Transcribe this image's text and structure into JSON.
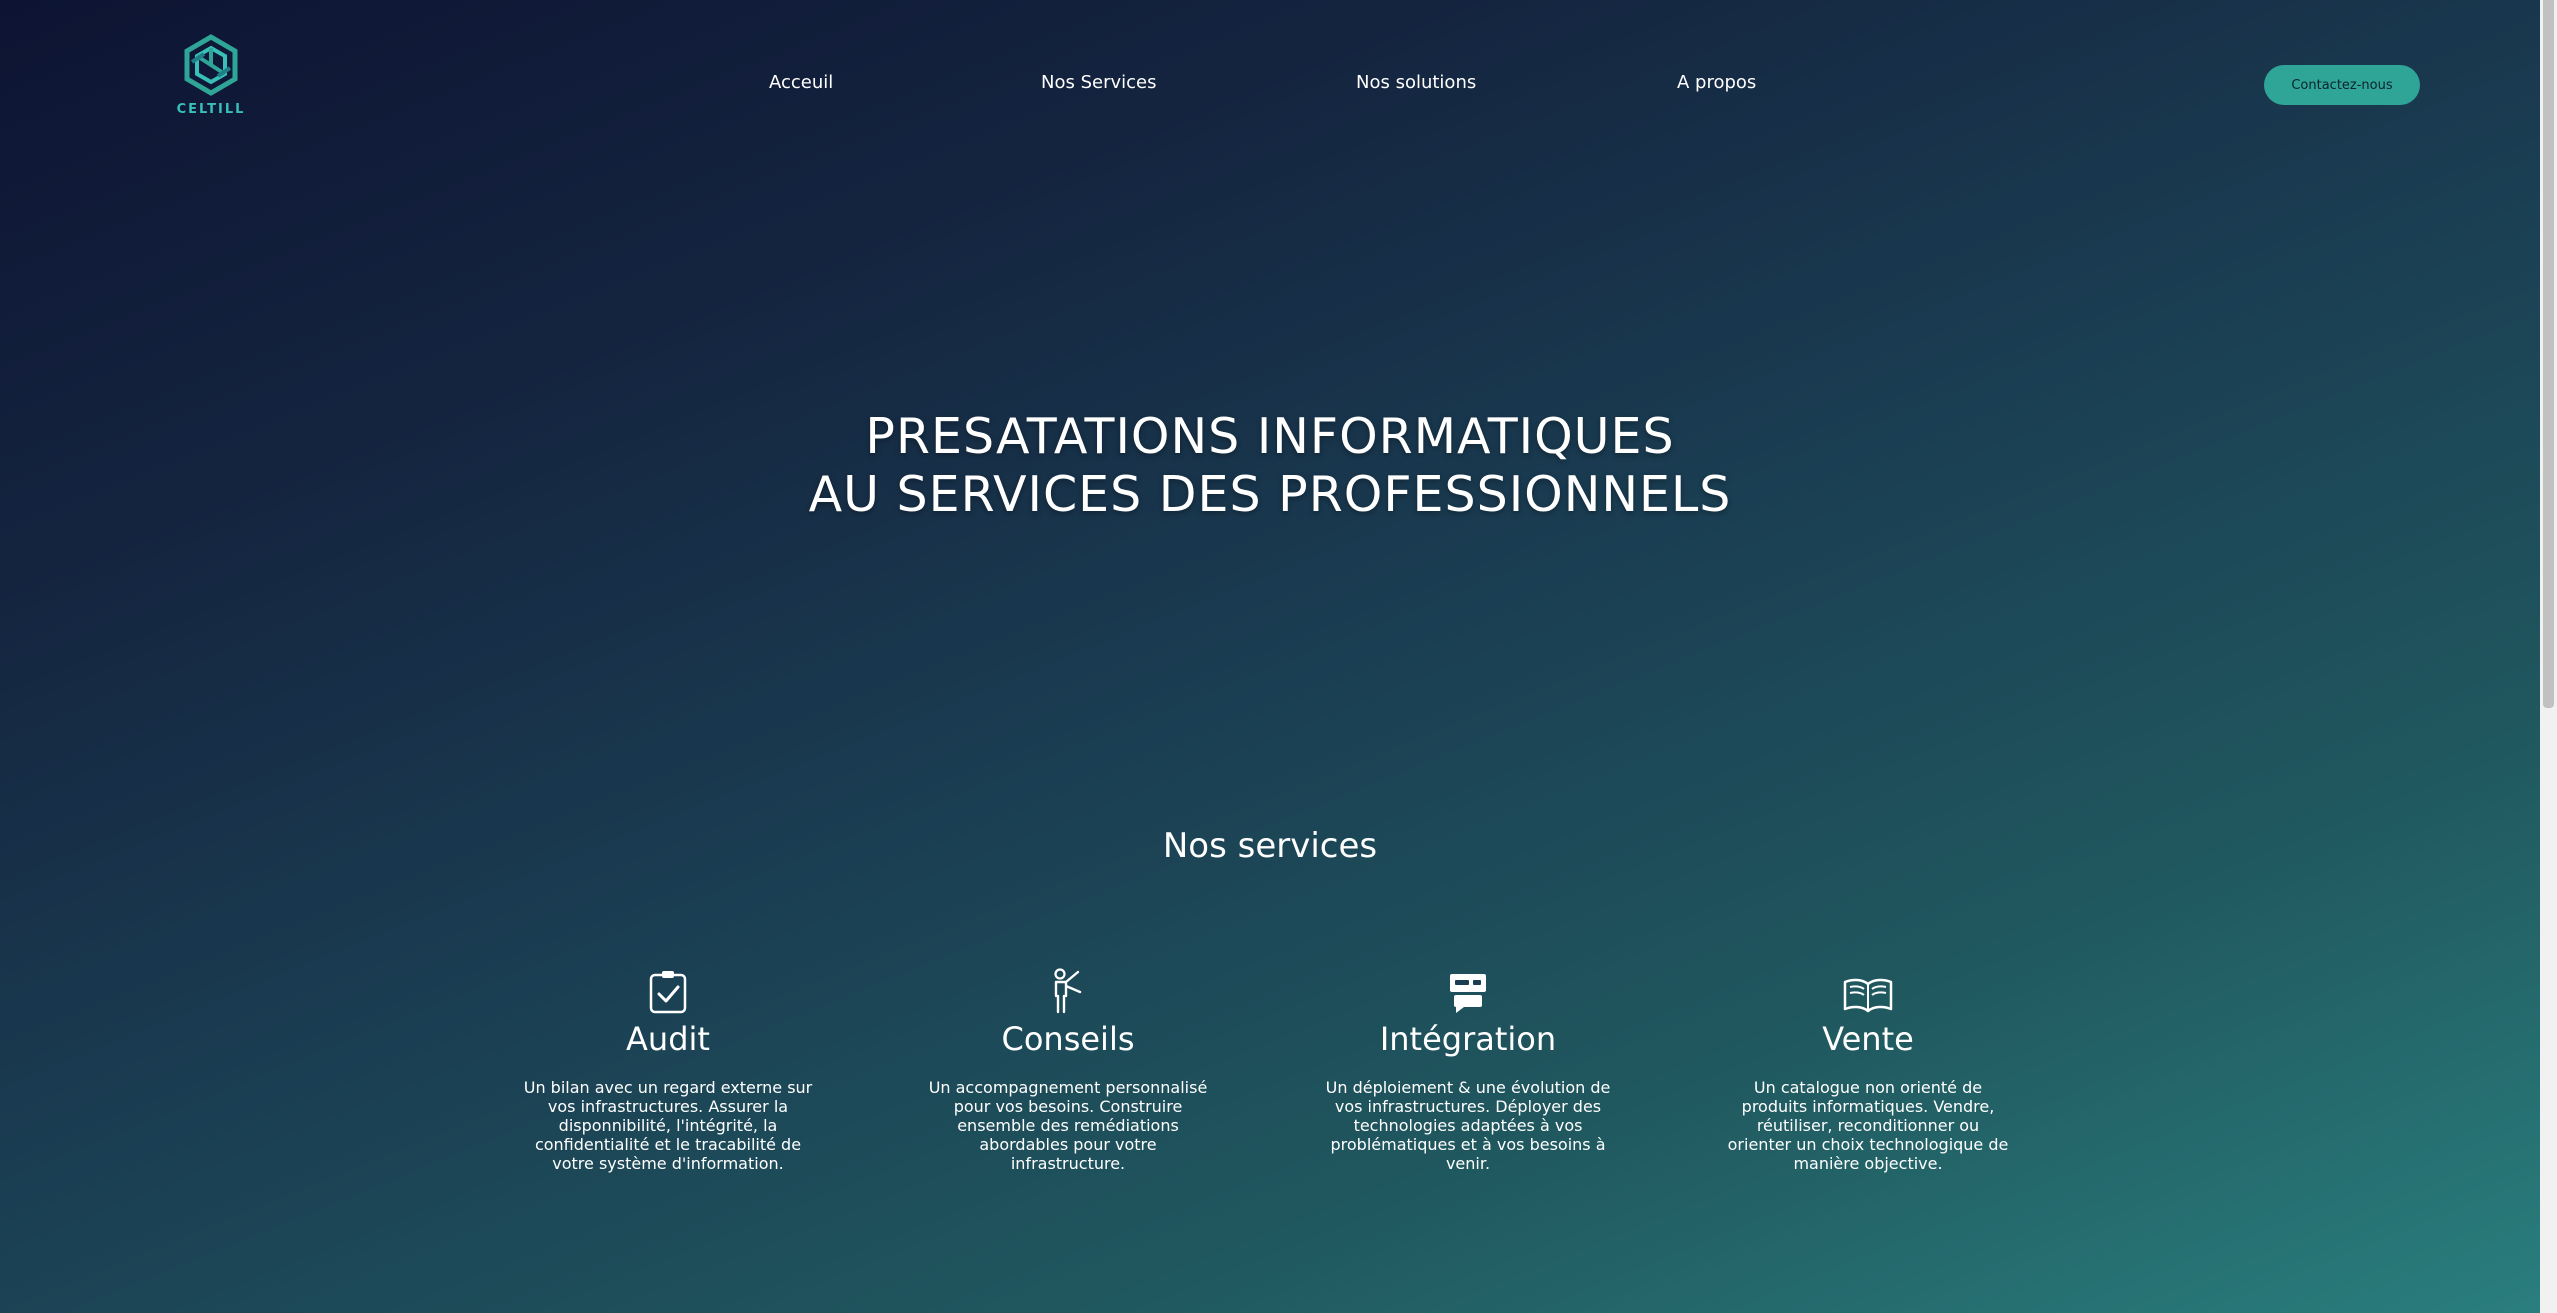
{
  "brand": {
    "name": "CELTILL",
    "accent": "#2fa597"
  },
  "nav": {
    "items": [
      {
        "label": "Acceuil"
      },
      {
        "label": "Nos Services"
      },
      {
        "label": "Nos solutions"
      },
      {
        "label": "A propos"
      }
    ],
    "cta_label": "Contactez-nous"
  },
  "hero": {
    "line1": "PRESATATIONS INFORMATIQUES",
    "line2": "AU SERVICES DES PROFESSIONNELS"
  },
  "services": {
    "title": "Nos services",
    "items": [
      {
        "icon": "clipboard-check-icon",
        "name": "Audit",
        "description": "Un bilan avec un regard externe sur vos infrastructures. Assurer la disponnibilité, l'intégrité, la confidentialité et le tracabilité de votre système d'information."
      },
      {
        "icon": "person-waving-icon",
        "name": "Conseils",
        "description": "Un accompagnement personnalisé pour vos besoins. Construire ensemble des remédiations abordables pour votre infrastructure."
      },
      {
        "icon": "server-icon",
        "name": "Intégration",
        "description": "Un déploiement & une évolution de vos infrastructures. Déployer des technologies adaptées à vos problématiques et à vos besoins à venir."
      },
      {
        "icon": "open-book-icon",
        "name": "Vente",
        "description": "Un catalogue non orienté de produits informatiques. Vendre, réutiliser, reconditionner ou orienter un choix technologique de manière objective."
      }
    ]
  }
}
